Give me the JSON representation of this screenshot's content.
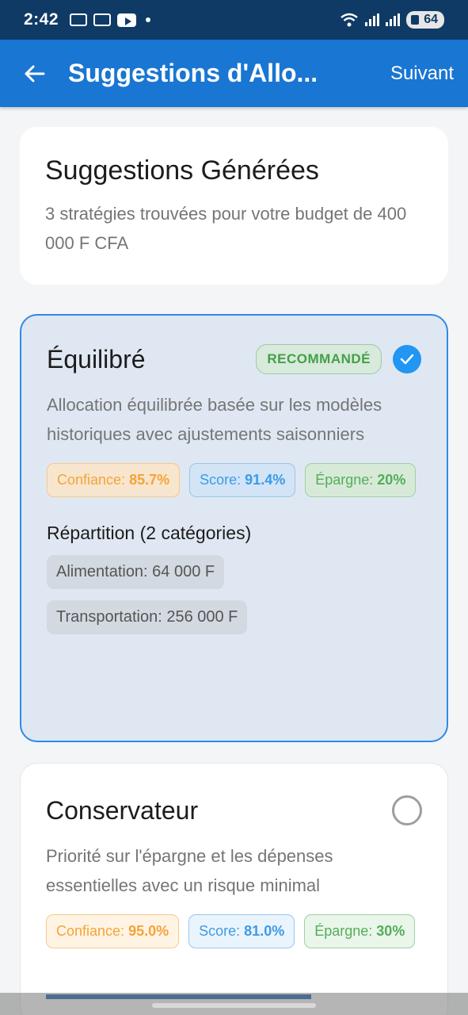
{
  "status_bar": {
    "time": "2:42",
    "battery": "64"
  },
  "app_bar": {
    "title": "Suggestions d'Allo...",
    "next_label": "Suivant"
  },
  "header": {
    "title": "Suggestions Générées",
    "subtitle": "3 stratégies trouvées pour votre budget de 400 000 F CFA"
  },
  "strategies": [
    {
      "name": "Équilibré",
      "badge": "RECOMMANDÉ",
      "selected": true,
      "description": "Allocation équilibrée basée sur les modèles historiques avec ajustements saisonniers",
      "confidence_label": "Confiance:",
      "confidence_value": "85.7%",
      "score_label": "Score:",
      "score_value": "91.4%",
      "savings_label": "Épargne:",
      "savings_value": "20%",
      "allocation_title": "Répartition (2 catégories)",
      "allocations": [
        "Alimentation: 64 000 F",
        "Transportation: 256 000 F"
      ]
    },
    {
      "name": "Conservateur",
      "selected": false,
      "description": "Priorité sur l'épargne et les dépenses essentielles avec un risque minimal",
      "confidence_label": "Confiance:",
      "confidence_value": "95.0%",
      "score_label": "Score:",
      "score_value": "81.0%",
      "savings_label": "Épargne:",
      "savings_value": "30%"
    }
  ],
  "icons": {
    "back": "arrow-left-icon",
    "check": "check-icon",
    "radio": "radio-unchecked-icon"
  },
  "colors": {
    "primary": "#1976d2",
    "status_bar": "#0f3a66",
    "selected_border": "#2d8ae6",
    "orange": "#f5a33a",
    "blue": "#3d9be6",
    "green": "#55ad59"
  }
}
